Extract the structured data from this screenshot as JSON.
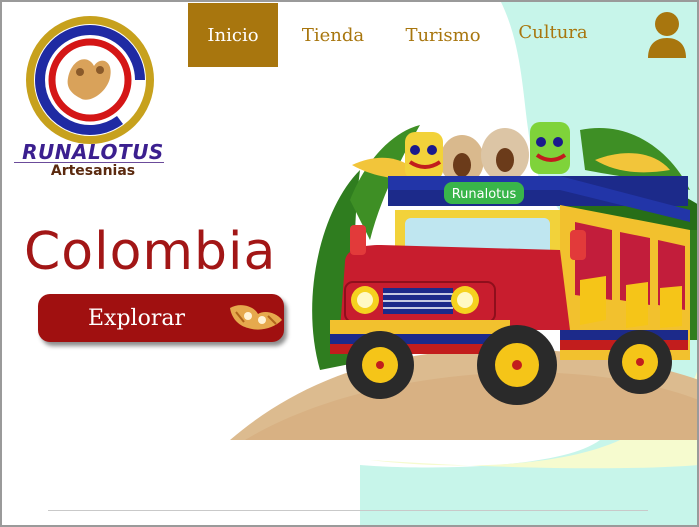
{
  "brand": {
    "name": "RUNALOTUS",
    "tagline": "Artesanias"
  },
  "nav": {
    "items": [
      {
        "label": "Inicio",
        "active": true
      },
      {
        "label": "Tienda",
        "active": false
      },
      {
        "label": "Turismo",
        "active": false
      },
      {
        "label": "Cultura",
        "active": false
      }
    ]
  },
  "user": {
    "icon": "user-icon"
  },
  "hero": {
    "title": "Colombia",
    "button_label": "Explorar",
    "button_icon": "artifact-icon",
    "bus_sign": "Runalotus"
  },
  "colors": {
    "accent_gold": "#a8760e",
    "title_red": "#a21616",
    "button_red": "#a01010",
    "mint_bg": "#bff3e8",
    "cream_bg": "#f9fbd0"
  }
}
